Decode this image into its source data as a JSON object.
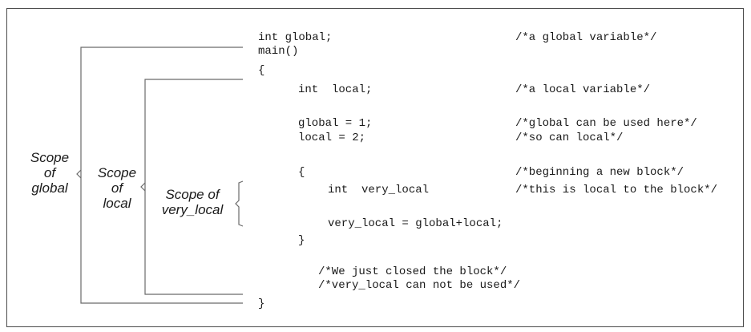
{
  "labels": {
    "global": [
      "Scope",
      "of",
      "global"
    ],
    "local": [
      "Scope",
      "of",
      "local"
    ],
    "very_local": [
      "Scope of",
      "very_local"
    ]
  },
  "code_lines": [
    "int global;",
    "main()",
    "{",
    "int  local;",
    "global = 1;",
    "local = 2;",
    "{",
    "int  very_local",
    "very_local = global+local;",
    "}",
    "/*We just closed the block*/",
    "/*very_local can not be used*/",
    "}"
  ],
  "comments": [
    "/*a global variable*/",
    "/*a local variable*/",
    "/*global can be used here*/",
    "/*so can local*/",
    "/*beginning a new block*/",
    "/*this is local to the block*/"
  ]
}
